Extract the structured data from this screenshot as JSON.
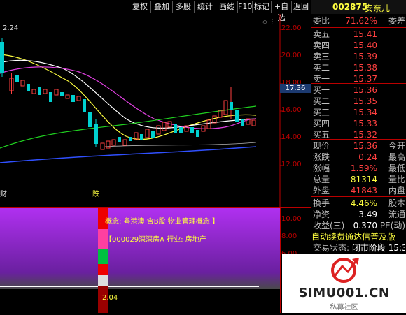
{
  "toolbar": {
    "buttons": [
      "复权",
      "叠加",
      "多股",
      "统计",
      "画线",
      "F10",
      "标记",
      "+自选",
      "返回"
    ]
  },
  "chart": {
    "left_high_label": "2.24",
    "y_ticks": [
      "22.00",
      "20.00",
      "18.00",
      "16.00",
      "14.00",
      "12.00"
    ],
    "current_price_tag": "17.36",
    "bottom_left_mark": "财",
    "bottom_mid_mark": "跌",
    "indicator_y_ticks": [
      "10.00",
      "8.00",
      "6.00",
      "4.00",
      "2.00"
    ]
  },
  "indicator": {
    "line1": "概念: 粤港澳 含B股 物业管理概念 】",
    "line2": "【000029深深房A  行业: 房地产",
    "bar_value": "2.04"
  },
  "quote": {
    "code": "002875",
    "name": "安奈儿",
    "ratio_label": "委比",
    "ratio_value": "71.62%",
    "ratio_extra": "委差",
    "asks": [
      {
        "label": "卖五",
        "price": "15.41"
      },
      {
        "label": "卖四",
        "price": "15.40"
      },
      {
        "label": "卖三",
        "price": "15.39"
      },
      {
        "label": "卖二",
        "price": "15.38"
      },
      {
        "label": "卖一",
        "price": "15.37"
      }
    ],
    "bids": [
      {
        "label": "买一",
        "price": "15.36"
      },
      {
        "label": "买二",
        "price": "15.35"
      },
      {
        "label": "买三",
        "price": "15.34"
      },
      {
        "label": "买四",
        "price": "15.33"
      },
      {
        "label": "买五",
        "price": "15.32"
      }
    ],
    "stats": [
      {
        "label": "现价",
        "value": "15.36",
        "label2": "今开"
      },
      {
        "label": "涨跌",
        "value": "0.24",
        "label2": "最高"
      },
      {
        "label": "涨幅",
        "value": "1.59%",
        "label2": "最低"
      },
      {
        "label": "总量",
        "value": "81314",
        "label2": "量比"
      },
      {
        "label": "外盘",
        "value": "41843",
        "label2": "内盘"
      }
    ],
    "stats2": [
      {
        "label": "换手",
        "value": "4.46%",
        "label2": "股本"
      },
      {
        "label": "净资",
        "value": "3.49",
        "label2": "流通"
      },
      {
        "label": "收益(三)",
        "value": "-0.370",
        "label2": "PE(动)"
      }
    ],
    "banner": "自动续费通达信普及版",
    "status_label": "交易状态:",
    "status_value": "闭市阶段",
    "status_time": "15:3"
  },
  "logo": {
    "text": "SIMU001.CN",
    "sub": "私募社区"
  }
}
